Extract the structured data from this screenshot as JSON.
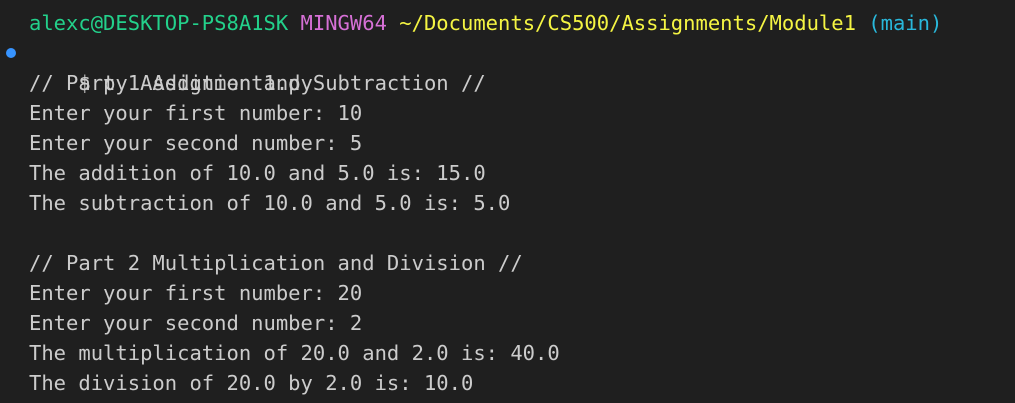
{
  "prompt_header": {
    "user_host": "alexc@DESKTOP-PS8A1SK",
    "system": "MINGW64",
    "path": "~/Documents/CS500/Assignments/Module1",
    "branch": "(main)"
  },
  "command": {
    "prompt_symbol": "$",
    "text": "py Assignment1.py",
    "decoration_color": "#3794ff"
  },
  "output": [
    "// Part 1 Addition and Subtraction //",
    "Enter your first number: 10",
    "Enter your second number: 5",
    "The addition of 10.0 and 5.0 is: 15.0",
    "The subtraction of 10.0 and 5.0 is: 5.0",
    "",
    "// Part 2 Multiplication and Division //",
    "Enter your first number: 20",
    "Enter your second number: 2",
    "The multiplication of 20.0 and 2.0 is: 40.0",
    "The division of 20.0 by 2.0 is: 10.0"
  ],
  "colors": {
    "background": "#1f1f1f",
    "foreground": "#cccccc",
    "user_host": "#23d18b",
    "system": "#d670d6",
    "path": "#f5f543",
    "branch": "#29b8db"
  }
}
